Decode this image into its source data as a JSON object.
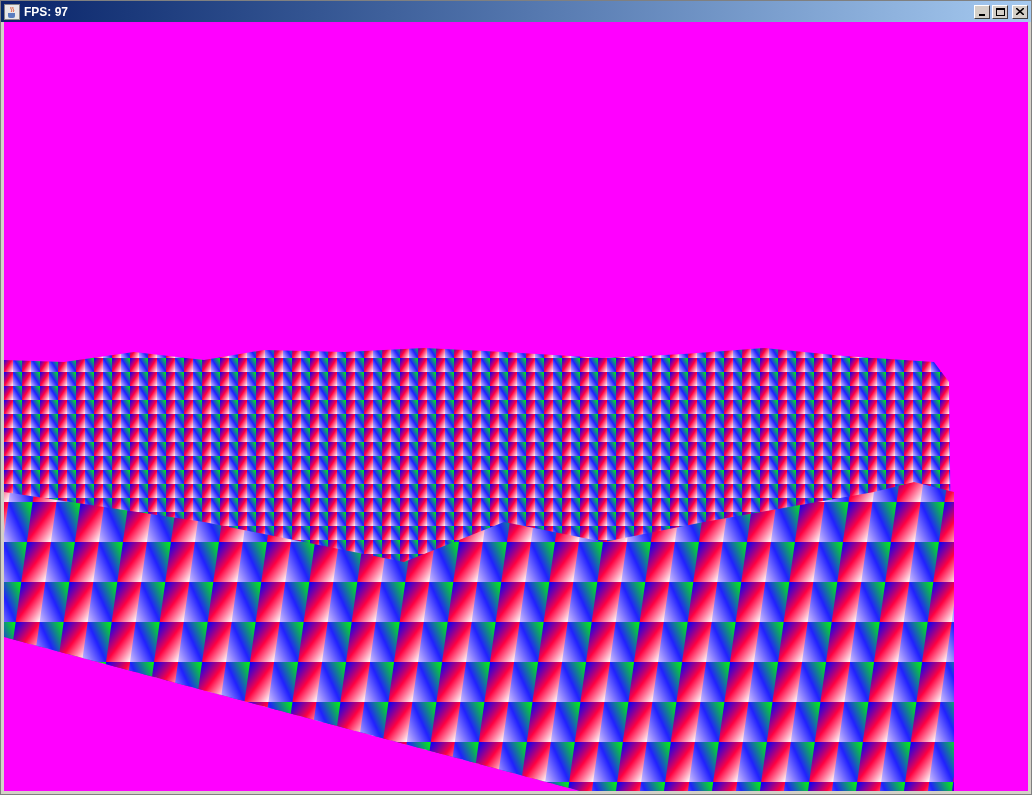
{
  "window": {
    "title": "FPS: 97"
  }
}
